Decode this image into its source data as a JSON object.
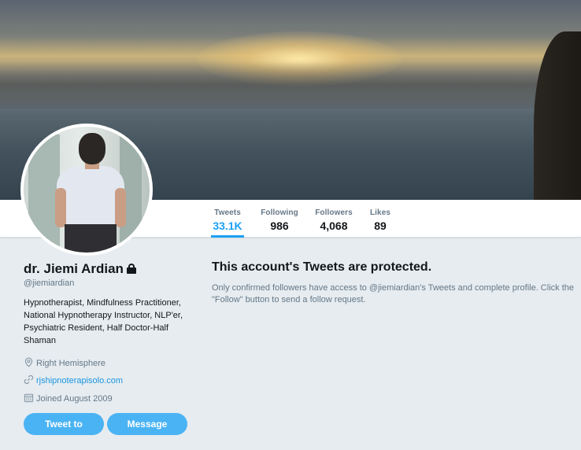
{
  "profile": {
    "name": "dr. Jiemi Ardian",
    "handle": "@jiemiardian",
    "bio": "Hypnotherapist, Mindfulness Practitioner, National Hypnotherapy Instructor, NLP'er, Psychiatric Resident, Half Doctor-Half Shaman",
    "location": "Right Hemisphere",
    "website": "rjshipnoterapisolo.com",
    "joined": "Joined August 2009"
  },
  "stats": [
    {
      "label": "Tweets",
      "value": "33.1K",
      "active": true
    },
    {
      "label": "Following",
      "value": "986",
      "active": false
    },
    {
      "label": "Followers",
      "value": "4,068",
      "active": false
    },
    {
      "label": "Likes",
      "value": "89",
      "active": false
    }
  ],
  "buttons": {
    "tweet_to": "Tweet to",
    "message": "Message"
  },
  "protected": {
    "title": "This account's Tweets are protected.",
    "body": "Only confirmed followers have access to @jiemiardian's Tweets and complete profile. Click the \"Follow\" button to send a follow request."
  },
  "icons": {
    "lock": "lock-icon",
    "location": "location-pin-icon",
    "link": "link-icon",
    "calendar": "calendar-icon"
  },
  "colors": {
    "accent": "#1da1f2",
    "button": "#4ab3f4",
    "background": "#e6ecf0",
    "muted_text": "#657786",
    "link": "#1b95e0"
  }
}
